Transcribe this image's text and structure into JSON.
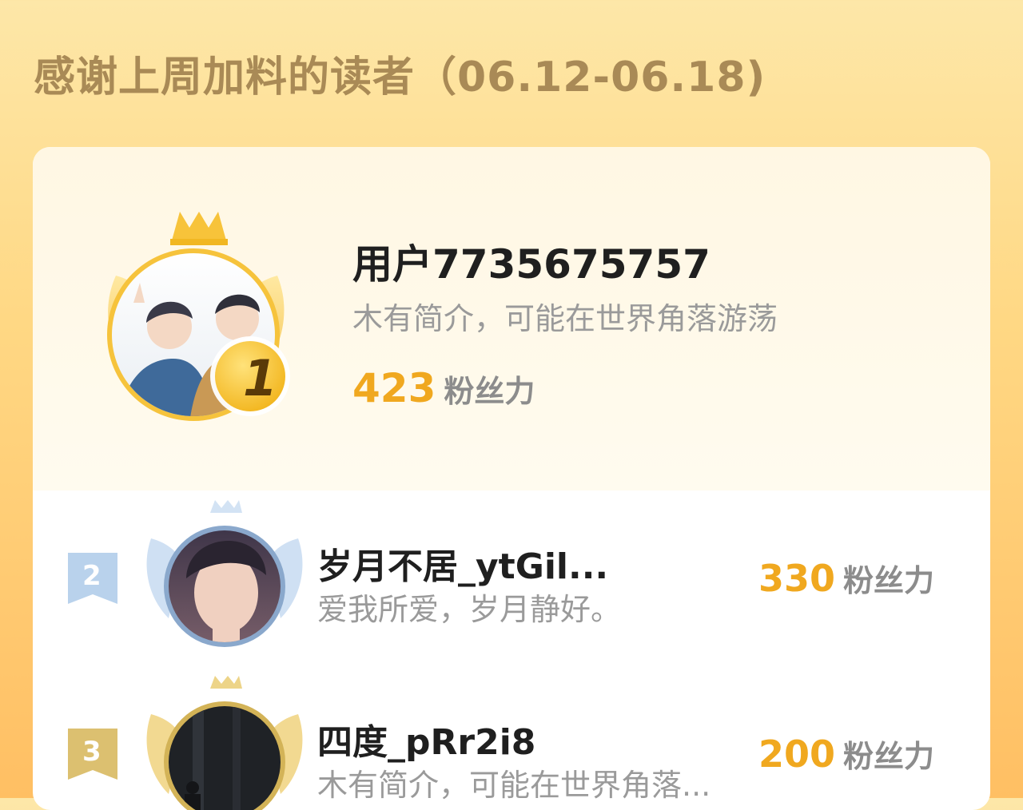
{
  "header": {
    "title": "感谢上周加料的读者（06.12-06.18)"
  },
  "colors": {
    "accent": "#f0a81f",
    "gold": "#f6c132",
    "silver": "#a9c7e7",
    "bronze": "#d9b95f"
  },
  "leaderboard": [
    {
      "rank": "1",
      "name": "用户7735675757",
      "bio": "木有简介，可能在世界角落游荡",
      "score": "423",
      "unit": "粉丝力"
    },
    {
      "rank": "2",
      "name": "岁月不居_ytGil...",
      "bio": "爱我所爱，岁月静好。",
      "score": "330",
      "unit": "粉丝力"
    },
    {
      "rank": "3",
      "name": "四度_pRr2i8",
      "bio": "木有简介，可能在世界角落...",
      "score": "200",
      "unit": "粉丝力"
    }
  ]
}
